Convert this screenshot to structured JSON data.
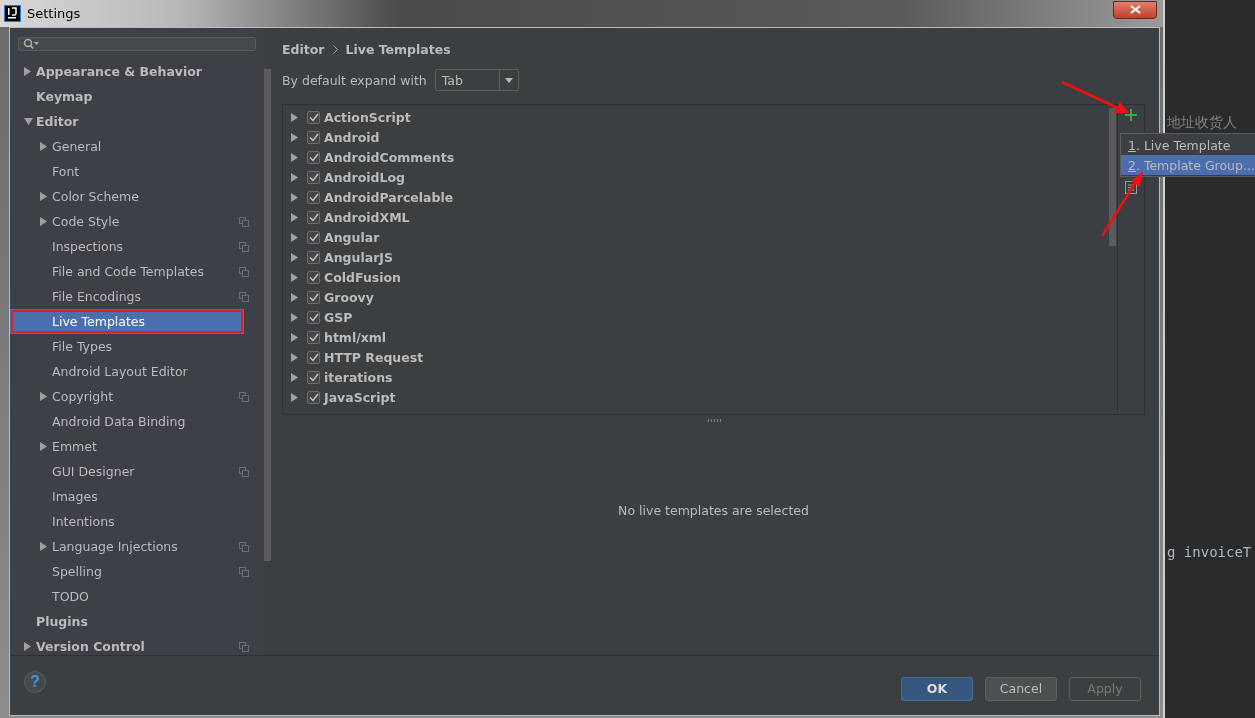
{
  "window": {
    "title": "Settings"
  },
  "sidebar": {
    "items": [
      {
        "label": "Appearance & Behavior",
        "expanded": false,
        "selected": false,
        "outlined": false,
        "project_icon": false
      },
      {
        "label": "Keymap",
        "selected": false,
        "outlined": false,
        "project_icon": false
      },
      {
        "label": "Editor",
        "expanded": true,
        "selected": false,
        "outlined": false,
        "project_icon": false,
        "children": [
          {
            "label": "General",
            "expanded": false,
            "selected": false,
            "outlined": false,
            "project_icon": false
          },
          {
            "label": "Font",
            "selected": false,
            "outlined": false,
            "project_icon": false
          },
          {
            "label": "Color Scheme",
            "expanded": false,
            "selected": false,
            "outlined": false,
            "project_icon": false
          },
          {
            "label": "Code Style",
            "expanded": false,
            "selected": false,
            "outlined": false,
            "project_icon": true
          },
          {
            "label": "Inspections",
            "selected": false,
            "outlined": false,
            "project_icon": true
          },
          {
            "label": "File and Code Templates",
            "selected": false,
            "outlined": false,
            "project_icon": true
          },
          {
            "label": "File Encodings",
            "selected": false,
            "outlined": false,
            "project_icon": true
          },
          {
            "label": "Live Templates",
            "selected": true,
            "outlined": true,
            "project_icon": false
          },
          {
            "label": "File Types",
            "selected": false,
            "outlined": false,
            "project_icon": false
          },
          {
            "label": "Android Layout Editor",
            "selected": false,
            "outlined": false,
            "project_icon": false
          },
          {
            "label": "Copyright",
            "expanded": false,
            "selected": false,
            "outlined": false,
            "project_icon": true
          },
          {
            "label": "Android Data Binding",
            "selected": false,
            "outlined": false,
            "project_icon": false
          },
          {
            "label": "Emmet",
            "expanded": false,
            "selected": false,
            "outlined": false,
            "project_icon": false
          },
          {
            "label": "GUI Designer",
            "selected": false,
            "outlined": false,
            "project_icon": true
          },
          {
            "label": "Images",
            "selected": false,
            "outlined": false,
            "project_icon": false
          },
          {
            "label": "Intentions",
            "selected": false,
            "outlined": false,
            "project_icon": false
          },
          {
            "label": "Language Injections",
            "expanded": false,
            "selected": false,
            "outlined": false,
            "project_icon": true
          },
          {
            "label": "Spelling",
            "selected": false,
            "outlined": false,
            "project_icon": true
          },
          {
            "label": "TODO",
            "selected": false,
            "outlined": false,
            "project_icon": false
          }
        ]
      },
      {
        "label": "Plugins",
        "selected": false,
        "outlined": false,
        "project_icon": false
      },
      {
        "label": "Version Control",
        "expanded": false,
        "selected": false,
        "outlined": false,
        "project_icon": true
      }
    ]
  },
  "breadcrumb": [
    "Editor",
    "Live Templates"
  ],
  "expand_with": {
    "label": "By default expand with",
    "value": "Tab"
  },
  "template_groups": [
    {
      "name": "ActionScript",
      "checked": true
    },
    {
      "name": "Android",
      "checked": true
    },
    {
      "name": "AndroidComments",
      "checked": true
    },
    {
      "name": "AndroidLog",
      "checked": true
    },
    {
      "name": "AndroidParcelable",
      "checked": true
    },
    {
      "name": "AndroidXML",
      "checked": true
    },
    {
      "name": "Angular",
      "checked": true
    },
    {
      "name": "AngularJS",
      "checked": true
    },
    {
      "name": "ColdFusion",
      "checked": true
    },
    {
      "name": "Groovy",
      "checked": true
    },
    {
      "name": "GSP",
      "checked": true
    },
    {
      "name": "html/xml",
      "checked": true
    },
    {
      "name": "HTTP Request",
      "checked": true
    },
    {
      "name": "iterations",
      "checked": true
    },
    {
      "name": "JavaScript",
      "checked": true
    }
  ],
  "add_menu": {
    "items": [
      {
        "label": "1. Live Template",
        "selected": false
      },
      {
        "label": "2. Template Group...",
        "selected": true
      }
    ]
  },
  "empty_message": "No live templates are selected",
  "help": "?",
  "buttons": [
    {
      "label": "OK",
      "kind": "default"
    },
    {
      "label": "Cancel",
      "kind": "normal"
    },
    {
      "label": "Apply",
      "kind": "disabled"
    }
  ],
  "background_editor": {
    "lines": [
      "地址收货人",
      "g invoiceT"
    ]
  }
}
